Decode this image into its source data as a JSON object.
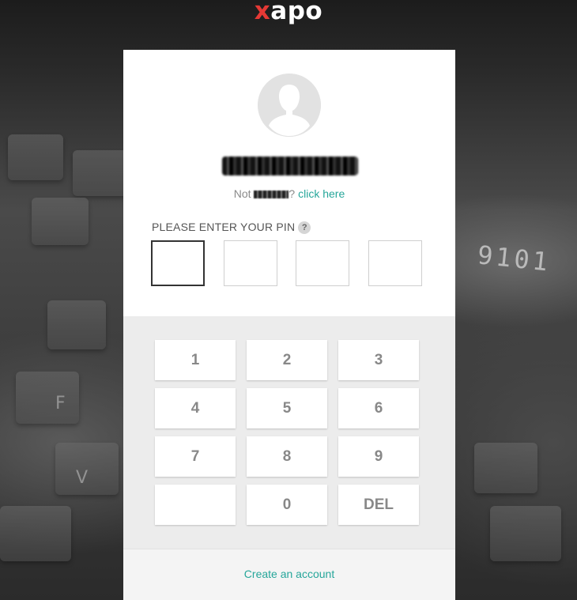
{
  "brand": {
    "logo_x": "x",
    "logo_rest": "apo",
    "accent": "#e53935",
    "link_color": "#26a69a"
  },
  "user": {
    "name_redacted": "████████████",
    "not_prefix": "Not ",
    "not_name_redacted": "█████",
    "not_suffix": "? ",
    "switch_link": "click here",
    "avatar_icon": "user-silhouette-icon"
  },
  "pin": {
    "label": "PLEASE ENTER YOUR PIN",
    "help_glyph": "?",
    "digits": [
      "",
      "",
      "",
      ""
    ]
  },
  "keypad": {
    "keys": [
      "1",
      "2",
      "3",
      "4",
      "5",
      "6",
      "7",
      "8",
      "9",
      "",
      "0",
      "DEL"
    ]
  },
  "footer": {
    "create_account": "Create an account"
  },
  "background": {
    "card_number_fragment": "9101"
  }
}
